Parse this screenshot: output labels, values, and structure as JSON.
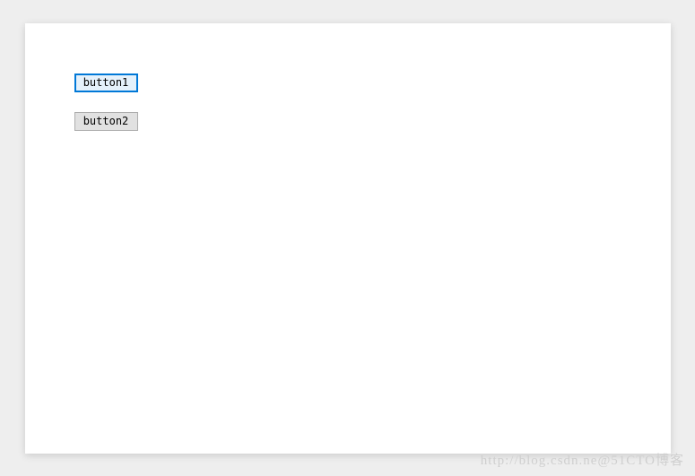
{
  "buttons": {
    "button1": {
      "label": "button1"
    },
    "button2": {
      "label": "button2"
    }
  },
  "watermark": "http://blog.csdn.ne@51CTO博客"
}
